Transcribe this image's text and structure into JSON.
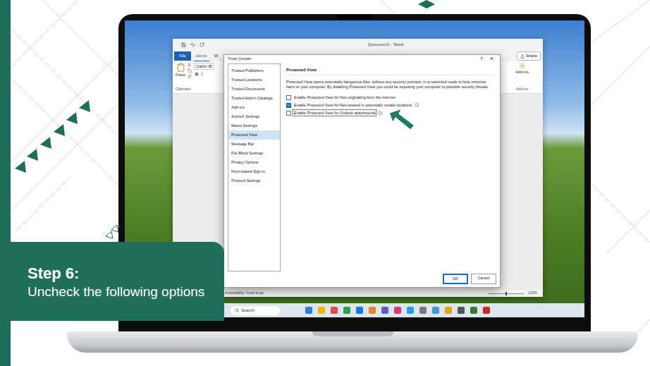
{
  "banner": {
    "step": "Step 6:",
    "caption": "Uncheck the following options"
  },
  "word": {
    "title": "Document2 - Word",
    "file_button": "File",
    "tabs": [
      {
        "label": "Home",
        "selected": true
      },
      {
        "label": "W",
        "selected": false
      }
    ],
    "share": "Share",
    "ribbon": {
      "paste": "Paste",
      "clipboard": "Clipboard",
      "font": "Calibri (B",
      "bold": "B",
      "italic": "I",
      "addins": "Add-ins",
      "addins_group": "Add-ins"
    },
    "status": "Accessibility: Good to go",
    "zoom": "100%"
  },
  "taskbar": {
    "search": "Search"
  },
  "dialog": {
    "title": "Trust Center",
    "help": "?",
    "close": "×",
    "sidebar": [
      {
        "label": "Trusted Publishers",
        "selected": false
      },
      {
        "label": "Trusted Locations",
        "selected": false
      },
      {
        "label": "Trusted Documents",
        "selected": false
      },
      {
        "label": "Trusted Add-in Catalogs",
        "selected": false
      },
      {
        "label": "Add-ins",
        "selected": false
      },
      {
        "label": "ActiveX Settings",
        "selected": false
      },
      {
        "label": "Macro Settings",
        "selected": false
      },
      {
        "label": "Protected View",
        "selected": true
      },
      {
        "label": "Message Bar",
        "selected": false
      },
      {
        "label": "File Block Settings",
        "selected": false
      },
      {
        "label": "Privacy Options",
        "selected": false
      },
      {
        "label": "Form-based Sign-in",
        "selected": false
      },
      {
        "label": "Protocol Settings",
        "selected": false
      }
    ],
    "heading": "Protected View",
    "description": "Protected View opens potentially dangerous files, without any security prompts, in a restricted mode to help minimize harm to your computer. By disabling Protected View you could be exposing your computer to possible security threats.",
    "options": [
      {
        "label": "Enable Protected View for files originating from the Internet",
        "checked": false,
        "info": false,
        "focused": false
      },
      {
        "label": "Enable Protected View for files located in potentially unsafe locations",
        "checked": true,
        "info": true,
        "focused": false
      },
      {
        "label": "Enable Protected View for Outlook attachments",
        "checked": false,
        "info": true,
        "focused": true
      }
    ],
    "buttons": [
      {
        "label": "OK",
        "default": true
      },
      {
        "label": "Cancel",
        "default": false
      }
    ]
  }
}
